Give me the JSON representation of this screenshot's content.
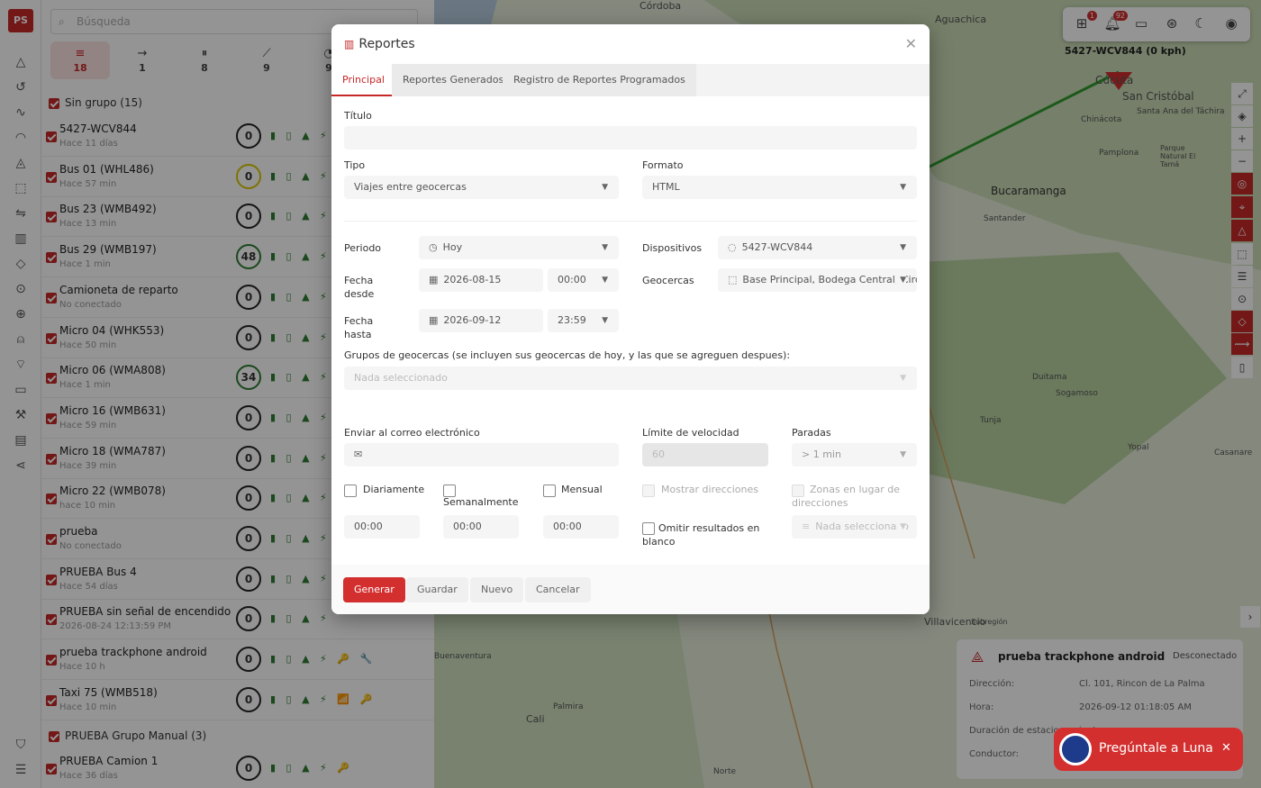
{
  "sidebar": {
    "logo": "PS LOGO",
    "icons": [
      "alert-icon",
      "history-icon",
      "activity-icon",
      "gauge-icon",
      "bell-icon",
      "geofence-icon",
      "routes-icon",
      "chart-icon",
      "tag-icon",
      "location-icon",
      "target-icon",
      "person-location-icon",
      "signal-icon",
      "video-icon",
      "wrench-icon",
      "invoice-icon",
      "share-icon",
      "shield-icon",
      "sliders-icon"
    ]
  },
  "panel": {
    "search_placeholder": "Búsqueda",
    "filters": [
      {
        "icon": "≡",
        "count": "18"
      },
      {
        "icon": "→",
        "count": "1"
      },
      {
        "icon": "⏸",
        "count": "8"
      },
      {
        "icon": "⟋",
        "count": "9"
      },
      {
        "icon": "◔",
        "count": "9"
      }
    ],
    "group1": "Sin grupo (15)",
    "vehicles": [
      {
        "name": "5427-WCV844",
        "time": "Hace 11 días",
        "speed": "0",
        "ring": "n",
        "icons": "▮ ▯ ▲ ⚡"
      },
      {
        "name": "Bus 01 (WHL486)",
        "time": "Hace 57 min",
        "speed": "0",
        "ring": "y",
        "icons": "▮ ▯ ▲ ⚡"
      },
      {
        "name": "Bus 23 (WMB492)",
        "time": "Hace 13 min",
        "speed": "0",
        "ring": "n",
        "icons": "▮ ▯ ▲ ⚡"
      },
      {
        "name": "Bus 29 (WMB197)",
        "time": "Hace 1 min",
        "speed": "48",
        "ring": "g",
        "icons": "▮ ▯ ▲ ⚡"
      },
      {
        "name": "Camioneta de reparto",
        "time": "No conectado",
        "speed": "0",
        "ring": "n",
        "icons": "▮ ▯ ▲ ⚡"
      },
      {
        "name": "Micro 04 (WHK553)",
        "time": "Hace 50 min",
        "speed": "0",
        "ring": "n",
        "icons": "▮ ▯ ▲ ⚡"
      },
      {
        "name": "Micro 06 (WMA808)",
        "time": "Hace 1 min",
        "speed": "34",
        "ring": "g",
        "icons": "▮ ▯ ▲ ⚡"
      },
      {
        "name": "Micro 16 (WMB631)",
        "time": "Hace 59 min",
        "speed": "0",
        "ring": "n",
        "icons": "▮ ▯ ▲ ⚡"
      },
      {
        "name": "Micro 18 (WMA787)",
        "time": "Hace 39 min",
        "speed": "0",
        "ring": "n",
        "icons": "▮ ▯ ▲ ⚡"
      },
      {
        "name": "Micro 22 (WMB078)",
        "time": "hace 10 min",
        "speed": "0",
        "ring": "n",
        "icons": "▮ ▯ ▲ ⚡"
      },
      {
        "name": "prueba",
        "time": "No conectado",
        "speed": "0",
        "ring": "n",
        "icons": "▮ ▯ ▲ ⚡"
      },
      {
        "name": "PRUEBA Bus 4",
        "time": "Hace 54 días",
        "speed": "0",
        "ring": "n",
        "icons": "▮ ▯ ▲ ⚡"
      },
      {
        "name": "PRUEBA sin señal de encendido",
        "time": "2026-08-24 12:13:59 PM",
        "speed": "0",
        "ring": "n",
        "icons": "▮ ▯ ▲ ⚡"
      },
      {
        "name": "prueba trackphone android",
        "time": "Hace 10 h",
        "speed": "0",
        "ring": "n",
        "icons": "▮ ▯ ▲ ⚡ 🔑 🔧"
      },
      {
        "name": "Taxi 75 (WMB518)",
        "time": "Hace 10 min",
        "speed": "0",
        "ring": "n",
        "icons": "▮ ▯ ▲ ⚡ 📶 🔑"
      }
    ],
    "group2": "PRUEBA Grupo Manual (3)",
    "vehicle_last": {
      "name": "PRUEBA Camion 1",
      "time": "Hace 36 días",
      "speed": "0",
      "icons": "▮ ▯ ▲ ⚡ 🔑"
    }
  },
  "map": {
    "device_label": "5427-WCV844 (0 kph)",
    "places": [
      "Córdoba",
      "Aguachica",
      "Cúcuta",
      "San Cristóbal",
      "Santa Ana del Táchira",
      "Chinácota",
      "Pamplona",
      "Bucaramanga",
      "Parque Natural El Tamá",
      "Santander",
      "Duitama",
      "Sogamoso",
      "Tunja",
      "Yopal",
      "Casanare",
      "Villavicencio",
      "Cali",
      "Palmira",
      "Buenaventura",
      "Norte",
      "Subregión"
    ],
    "notif_count": "1",
    "alert_count": "92",
    "device_card": {
      "name": "prueba trackphone android",
      "status": "Desconectado",
      "rows": [
        {
          "k": "Dirección:",
          "v": "Cl. 101, Rincon de La Palma..."
        },
        {
          "k": "Hora:",
          "v": "2026-09-12 01:18:05 AM"
        },
        {
          "k": "Duración de estacionamiento:",
          "v": ""
        },
        {
          "k": "Conductor:",
          "v": ""
        }
      ]
    },
    "luna": "Pregúntale a Luna"
  },
  "modal": {
    "title": "Reportes",
    "tabs": [
      "Principal",
      "Reportes Generados",
      "Registro de Reportes Programados"
    ],
    "titulo_label": "Título",
    "titulo_value": "",
    "tipo_label": "Tipo",
    "tipo_value": "Viajes entre geocercas",
    "formato_label": "Formato",
    "formato_value": "HTML",
    "periodo_label": "Periodo",
    "periodo_value": "Hoy",
    "dispositivos_label": "Dispositivos",
    "dispositivos_value": "5427-WCV844",
    "desde_label": "Fecha desde",
    "desde_date": "2026-08-15",
    "desde_time": "00:00",
    "hasta_label": "Fecha hasta",
    "hasta_date": "2026-09-12",
    "hasta_time": "23:59",
    "geocercas_label": "Geocercas",
    "geocercas_value": "Base Principal, Bodega Central, Circ",
    "grupos_label": "Grupos de geocercas (se incluyen sus geocercas de hoy, y las que se agreguen despues):",
    "grupos_placeholder": "Nada seleccionado",
    "email_label": "Enviar al correo electrónico",
    "limite_label": "Límite de velocidad",
    "limite_value": "60",
    "paradas_label": "Paradas",
    "paradas_value": "> 1 min",
    "diario_label": "Diariamente",
    "semanal_label": "Semanalmente",
    "mensual_label": "Mensual",
    "diario_time": "00:00",
    "semanal_time": "00:00",
    "mensual_time": "00:00",
    "mostrar_label": "Mostrar direcciones",
    "zonas_label": "Zonas en lugar de direcciones",
    "omitir_label": "Omitir resultados en blanco",
    "zonas_placeholder": "Nada seleccionado",
    "buttons": {
      "generar": "Generar",
      "guardar": "Guardar",
      "nuevo": "Nuevo",
      "cancelar": "Cancelar"
    }
  }
}
